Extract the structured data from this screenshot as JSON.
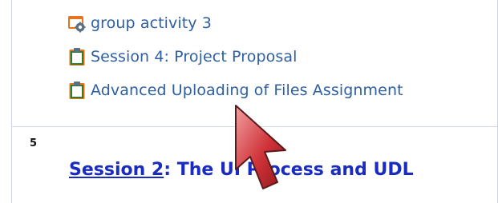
{
  "activities": [
    {
      "label": "group activity 3",
      "icon": "forum-icon"
    },
    {
      "label": "Session 4: Project Proposal",
      "icon": "assignment-icon"
    },
    {
      "label": "Advanced Uploading of Files Assignment",
      "icon": "assignment-icon"
    }
  ],
  "section": {
    "number": "5",
    "link_text": "Session 2",
    "title_rest": ": The UI Process and UDL"
  },
  "colors": {
    "activity_link": "#2d5fa3",
    "section_title": "#1a2bbf",
    "divider": "#cfd6de",
    "cursor": "#c0262b"
  }
}
